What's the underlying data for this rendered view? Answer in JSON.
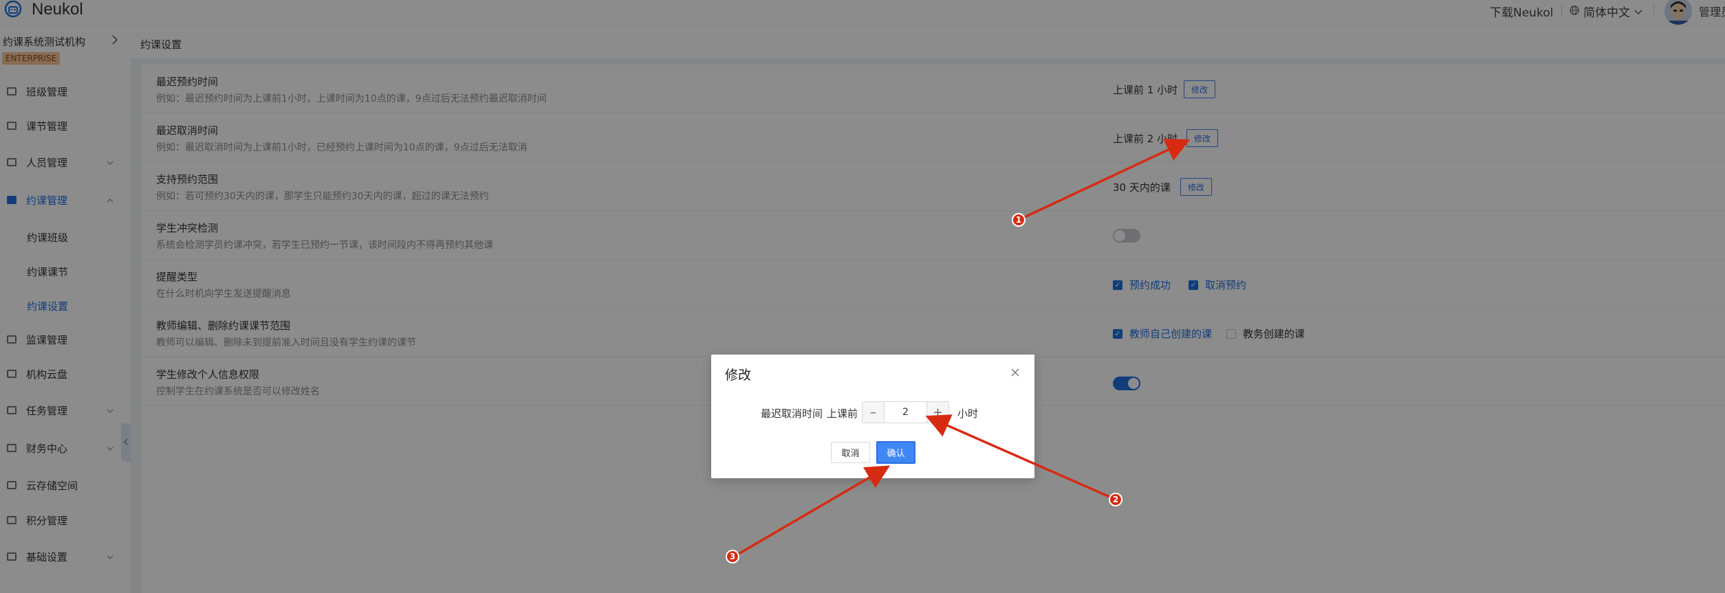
{
  "header": {
    "brand": "Neukol",
    "download": "下载Neukol",
    "language": "简体中文",
    "user": "管理员"
  },
  "sidebar": {
    "org": "约课系统测试机构",
    "badge": "ENTERPRISE",
    "items": [
      {
        "label": "班级管理"
      },
      {
        "label": "课节管理"
      },
      {
        "label": "人员管理"
      },
      {
        "label": "约课管理"
      },
      {
        "label": "约课班级"
      },
      {
        "label": "约课课节"
      },
      {
        "label": "约课设置"
      },
      {
        "label": "监课管理"
      },
      {
        "label": "机构云盘"
      },
      {
        "label": "任务管理"
      },
      {
        "label": "财务中心"
      },
      {
        "label": "云存储空间"
      },
      {
        "label": "积分管理"
      },
      {
        "label": "基础设置"
      }
    ]
  },
  "breadcrumb": "约课设置",
  "settings": [
    {
      "title": "最迟预约时间",
      "desc": "例如：最迟预约时间为上课前1小时，上课时间为10点的课，9点过后无法预约最迟取消时间",
      "value": "上课前 1 小时",
      "edit": "修改"
    },
    {
      "title": "最迟取消时间",
      "desc": "例如：最迟取消时间为上课前1小时，已经预约上课时间为10点的课，9点过后无法取消",
      "value": "上课前 2 小时",
      "edit": "修改"
    },
    {
      "title": "支持预约范围",
      "desc": "例如：若可预约30天内的课，那学生只能预约30天内的课，超过的课无法预约",
      "value": "30 天内的课",
      "edit": "修改"
    },
    {
      "title": "学生冲突检测",
      "desc": "系统会检测学员约课冲突，若学生已预约一节课，该时间段内不得再预约其他课",
      "switch": "off"
    },
    {
      "title": "提醒类型",
      "desc": "在什么时机向学生发送提醒消息",
      "options": [
        "预约成功",
        "取消预约"
      ]
    },
    {
      "title": "教师编辑、删除约课课节范围",
      "desc": "教师可以编辑、删除未到提前准入时间且没有学生约课的课节",
      "options": [
        "教师自己创建的课",
        "教务创建的课"
      ]
    },
    {
      "title": "学生修改个人信息权限",
      "desc": "控制学生在约课系统是否可以修改姓名",
      "switch": "on"
    }
  ],
  "modal": {
    "title": "修改",
    "label": "最迟取消时间",
    "prefix": "上课前",
    "value": "2",
    "suffix": "小时",
    "cancel": "取消",
    "confirm": "确认",
    "close_icon": "close-icon"
  },
  "annotations": {
    "markers": [
      "1",
      "2",
      "3"
    ],
    "color": "#d62b12"
  }
}
